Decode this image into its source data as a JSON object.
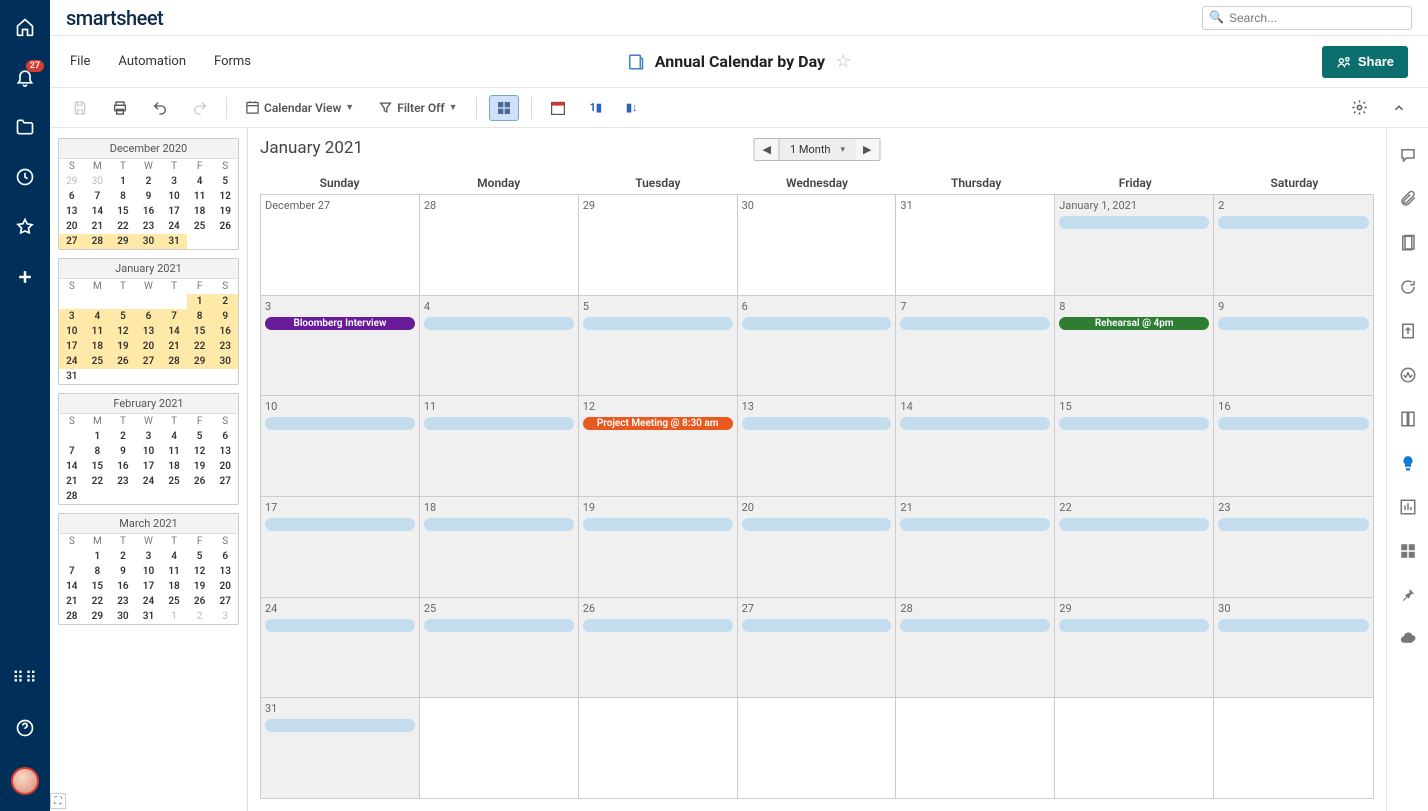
{
  "logo": "smartsheet",
  "search": {
    "placeholder": "Search..."
  },
  "notifications": {
    "count": "27"
  },
  "menu": {
    "file": "File",
    "automation": "Automation",
    "forms": "Forms"
  },
  "sheet": {
    "title": "Annual Calendar by Day"
  },
  "share": {
    "label": "Share"
  },
  "toolbar": {
    "view_label": "Calendar View",
    "filter_label": "Filter Off"
  },
  "period": {
    "label": "1 Month"
  },
  "calendar": {
    "title": "January 2021",
    "dow": [
      "Sunday",
      "Monday",
      "Tuesday",
      "Wednesday",
      "Thursday",
      "Friday",
      "Saturday"
    ],
    "weeks": [
      [
        {
          "label": "December 27",
          "prev": true
        },
        {
          "label": "28",
          "prev": true
        },
        {
          "label": "29",
          "prev": true
        },
        {
          "label": "30",
          "prev": true
        },
        {
          "label": "31",
          "prev": true
        },
        {
          "label": "January 1, 2021",
          "events": [
            {
              "type": "blue"
            }
          ]
        },
        {
          "label": "2",
          "events": [
            {
              "type": "blue"
            }
          ]
        }
      ],
      [
        {
          "label": "3",
          "events": [
            {
              "type": "purple",
              "title": "Bloomberg Interview"
            }
          ]
        },
        {
          "label": "4",
          "events": [
            {
              "type": "blue"
            }
          ]
        },
        {
          "label": "5",
          "events": [
            {
              "type": "blue"
            }
          ]
        },
        {
          "label": "6",
          "events": [
            {
              "type": "blue"
            }
          ]
        },
        {
          "label": "7",
          "events": [
            {
              "type": "blue"
            }
          ]
        },
        {
          "label": "8",
          "events": [
            {
              "type": "green",
              "title": "Rehearsal @ 4pm"
            }
          ]
        },
        {
          "label": "9",
          "events": [
            {
              "type": "blue"
            }
          ]
        }
      ],
      [
        {
          "label": "10",
          "events": [
            {
              "type": "blue"
            }
          ]
        },
        {
          "label": "11",
          "events": [
            {
              "type": "blue"
            }
          ]
        },
        {
          "label": "12",
          "events": [
            {
              "type": "orange",
              "title": "Project Meeting @ 8:30 am"
            }
          ]
        },
        {
          "label": "13",
          "events": [
            {
              "type": "blue"
            }
          ]
        },
        {
          "label": "14",
          "events": [
            {
              "type": "blue"
            }
          ]
        },
        {
          "label": "15",
          "events": [
            {
              "type": "blue"
            }
          ]
        },
        {
          "label": "16",
          "events": [
            {
              "type": "blue"
            }
          ]
        }
      ],
      [
        {
          "label": "17",
          "events": [
            {
              "type": "blue"
            }
          ]
        },
        {
          "label": "18",
          "events": [
            {
              "type": "blue"
            }
          ]
        },
        {
          "label": "19",
          "events": [
            {
              "type": "blue"
            }
          ]
        },
        {
          "label": "20",
          "events": [
            {
              "type": "blue"
            }
          ]
        },
        {
          "label": "21",
          "events": [
            {
              "type": "blue"
            }
          ]
        },
        {
          "label": "22",
          "events": [
            {
              "type": "blue"
            }
          ]
        },
        {
          "label": "23",
          "events": [
            {
              "type": "blue"
            }
          ]
        }
      ],
      [
        {
          "label": "24",
          "events": [
            {
              "type": "blue"
            }
          ]
        },
        {
          "label": "25",
          "events": [
            {
              "type": "blue"
            }
          ]
        },
        {
          "label": "26",
          "events": [
            {
              "type": "blue"
            }
          ]
        },
        {
          "label": "27",
          "events": [
            {
              "type": "blue"
            }
          ]
        },
        {
          "label": "28",
          "events": [
            {
              "type": "blue"
            }
          ]
        },
        {
          "label": "29",
          "events": [
            {
              "type": "blue"
            }
          ]
        },
        {
          "label": "30",
          "events": [
            {
              "type": "blue"
            }
          ]
        }
      ],
      [
        {
          "label": "31",
          "events": [
            {
              "type": "blue"
            }
          ]
        },
        {
          "label": "",
          "prev": true
        },
        {
          "label": "",
          "prev": true
        },
        {
          "label": "",
          "prev": true
        },
        {
          "label": "",
          "prev": true
        },
        {
          "label": "",
          "prev": true
        },
        {
          "label": "",
          "prev": true
        }
      ]
    ]
  },
  "mini_dow": [
    "S",
    "M",
    "T",
    "W",
    "T",
    "F",
    "S"
  ],
  "mini_months": [
    {
      "title": "December 2020",
      "days": [
        {
          "n": "29",
          "m": true
        },
        {
          "n": "30",
          "m": true
        },
        {
          "n": "1"
        },
        {
          "n": "2"
        },
        {
          "n": "3"
        },
        {
          "n": "4"
        },
        {
          "n": "5"
        },
        {
          "n": "6"
        },
        {
          "n": "7"
        },
        {
          "n": "8"
        },
        {
          "n": "9"
        },
        {
          "n": "10"
        },
        {
          "n": "11"
        },
        {
          "n": "12"
        },
        {
          "n": "13"
        },
        {
          "n": "14"
        },
        {
          "n": "15"
        },
        {
          "n": "16"
        },
        {
          "n": "17"
        },
        {
          "n": "18"
        },
        {
          "n": "19"
        },
        {
          "n": "20"
        },
        {
          "n": "21"
        },
        {
          "n": "22"
        },
        {
          "n": "23"
        },
        {
          "n": "24"
        },
        {
          "n": "25"
        },
        {
          "n": "26"
        },
        {
          "n": "27",
          "hl": true
        },
        {
          "n": "28",
          "hl": true
        },
        {
          "n": "29",
          "hl": true
        },
        {
          "n": "30",
          "hl": true
        },
        {
          "n": "31",
          "hl": true
        }
      ]
    },
    {
      "title": "January 2021",
      "days": [
        {
          "n": ""
        },
        {
          "n": ""
        },
        {
          "n": ""
        },
        {
          "n": ""
        },
        {
          "n": ""
        },
        {
          "n": "1",
          "hl": true
        },
        {
          "n": "2",
          "hl": true
        },
        {
          "n": "3",
          "hl": true
        },
        {
          "n": "4",
          "hl": true
        },
        {
          "n": "5",
          "hl": true
        },
        {
          "n": "6",
          "hl": true
        },
        {
          "n": "7",
          "hl": true
        },
        {
          "n": "8",
          "hl": true
        },
        {
          "n": "9",
          "hl": true
        },
        {
          "n": "10",
          "hl": true
        },
        {
          "n": "11",
          "hl": true
        },
        {
          "n": "12",
          "hl": true
        },
        {
          "n": "13",
          "hl": true
        },
        {
          "n": "14",
          "hl": true
        },
        {
          "n": "15",
          "hl": true
        },
        {
          "n": "16",
          "hl": true
        },
        {
          "n": "17",
          "hl": true
        },
        {
          "n": "18",
          "hl": true
        },
        {
          "n": "19",
          "hl": true
        },
        {
          "n": "20",
          "hl": true
        },
        {
          "n": "21",
          "hl": true
        },
        {
          "n": "22",
          "hl": true
        },
        {
          "n": "23",
          "hl": true
        },
        {
          "n": "24",
          "hl": true
        },
        {
          "n": "25",
          "hl": true
        },
        {
          "n": "26",
          "hl": true
        },
        {
          "n": "27",
          "hl": true
        },
        {
          "n": "28",
          "hl": true
        },
        {
          "n": "29",
          "hl": true
        },
        {
          "n": "30",
          "hl": true
        },
        {
          "n": "31",
          "extra": true
        }
      ]
    },
    {
      "title": "February 2021",
      "days": [
        {
          "n": ""
        },
        {
          "n": "1"
        },
        {
          "n": "2"
        },
        {
          "n": "3"
        },
        {
          "n": "4"
        },
        {
          "n": "5"
        },
        {
          "n": "6"
        },
        {
          "n": "7"
        },
        {
          "n": "8"
        },
        {
          "n": "9"
        },
        {
          "n": "10"
        },
        {
          "n": "11"
        },
        {
          "n": "12"
        },
        {
          "n": "13"
        },
        {
          "n": "14"
        },
        {
          "n": "15"
        },
        {
          "n": "16"
        },
        {
          "n": "17"
        },
        {
          "n": "18"
        },
        {
          "n": "19"
        },
        {
          "n": "20"
        },
        {
          "n": "21"
        },
        {
          "n": "22"
        },
        {
          "n": "23"
        },
        {
          "n": "24"
        },
        {
          "n": "25"
        },
        {
          "n": "26"
        },
        {
          "n": "27"
        },
        {
          "n": "28"
        }
      ]
    },
    {
      "title": "March 2021",
      "days": [
        {
          "n": ""
        },
        {
          "n": "1"
        },
        {
          "n": "2"
        },
        {
          "n": "3"
        },
        {
          "n": "4"
        },
        {
          "n": "5"
        },
        {
          "n": "6"
        },
        {
          "n": "7"
        },
        {
          "n": "8"
        },
        {
          "n": "9"
        },
        {
          "n": "10"
        },
        {
          "n": "11"
        },
        {
          "n": "12"
        },
        {
          "n": "13"
        },
        {
          "n": "14"
        },
        {
          "n": "15"
        },
        {
          "n": "16"
        },
        {
          "n": "17"
        },
        {
          "n": "18"
        },
        {
          "n": "19"
        },
        {
          "n": "20"
        },
        {
          "n": "21"
        },
        {
          "n": "22"
        },
        {
          "n": "23"
        },
        {
          "n": "24"
        },
        {
          "n": "25"
        },
        {
          "n": "26"
        },
        {
          "n": "27"
        },
        {
          "n": "28"
        },
        {
          "n": "29"
        },
        {
          "n": "30"
        },
        {
          "n": "31"
        },
        {
          "n": "1",
          "m": true
        },
        {
          "n": "2",
          "m": true
        },
        {
          "n": "3",
          "m": true
        }
      ]
    }
  ]
}
